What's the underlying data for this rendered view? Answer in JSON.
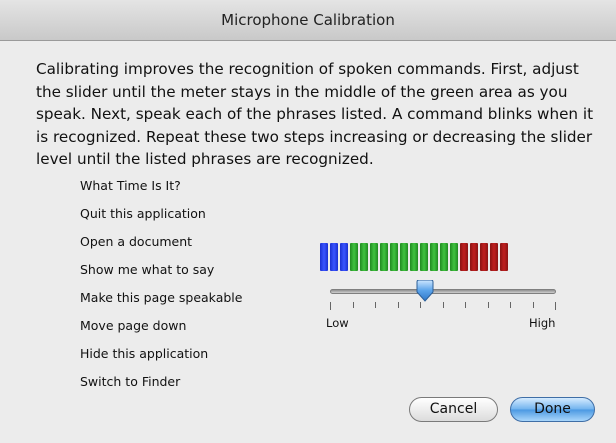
{
  "window": {
    "title": "Microphone Calibration"
  },
  "description": "Calibrating improves the recognition of spoken commands. First, adjust the slider until the meter stays in the middle of the green area as you speak. Next, speak each of the phrases listed. A command blinks when it is recognized. Repeat these two steps increasing or decreasing the slider level until the listed phrases are recognized.",
  "phrases": [
    "What Time Is It?",
    "Quit this application",
    "Open a document",
    "Show me what to say",
    "Make this page speakable",
    "Move page down",
    "Hide this application",
    "Switch to Finder"
  ],
  "meter": {
    "segments": [
      "blue",
      "blue",
      "blue",
      "green",
      "green",
      "green",
      "green",
      "green",
      "green",
      "green",
      "green",
      "green",
      "green",
      "green",
      "red",
      "red",
      "red",
      "red",
      "red"
    ],
    "colors": {
      "blue": "#2a44f0",
      "green": "#33b033",
      "red": "#b01a1a"
    }
  },
  "slider": {
    "low_label": "Low",
    "high_label": "High",
    "level": 0.42,
    "tick_count": 11,
    "thumb_color": "#4f9de8"
  },
  "buttons": {
    "cancel": "Cancel",
    "done": "Done"
  }
}
